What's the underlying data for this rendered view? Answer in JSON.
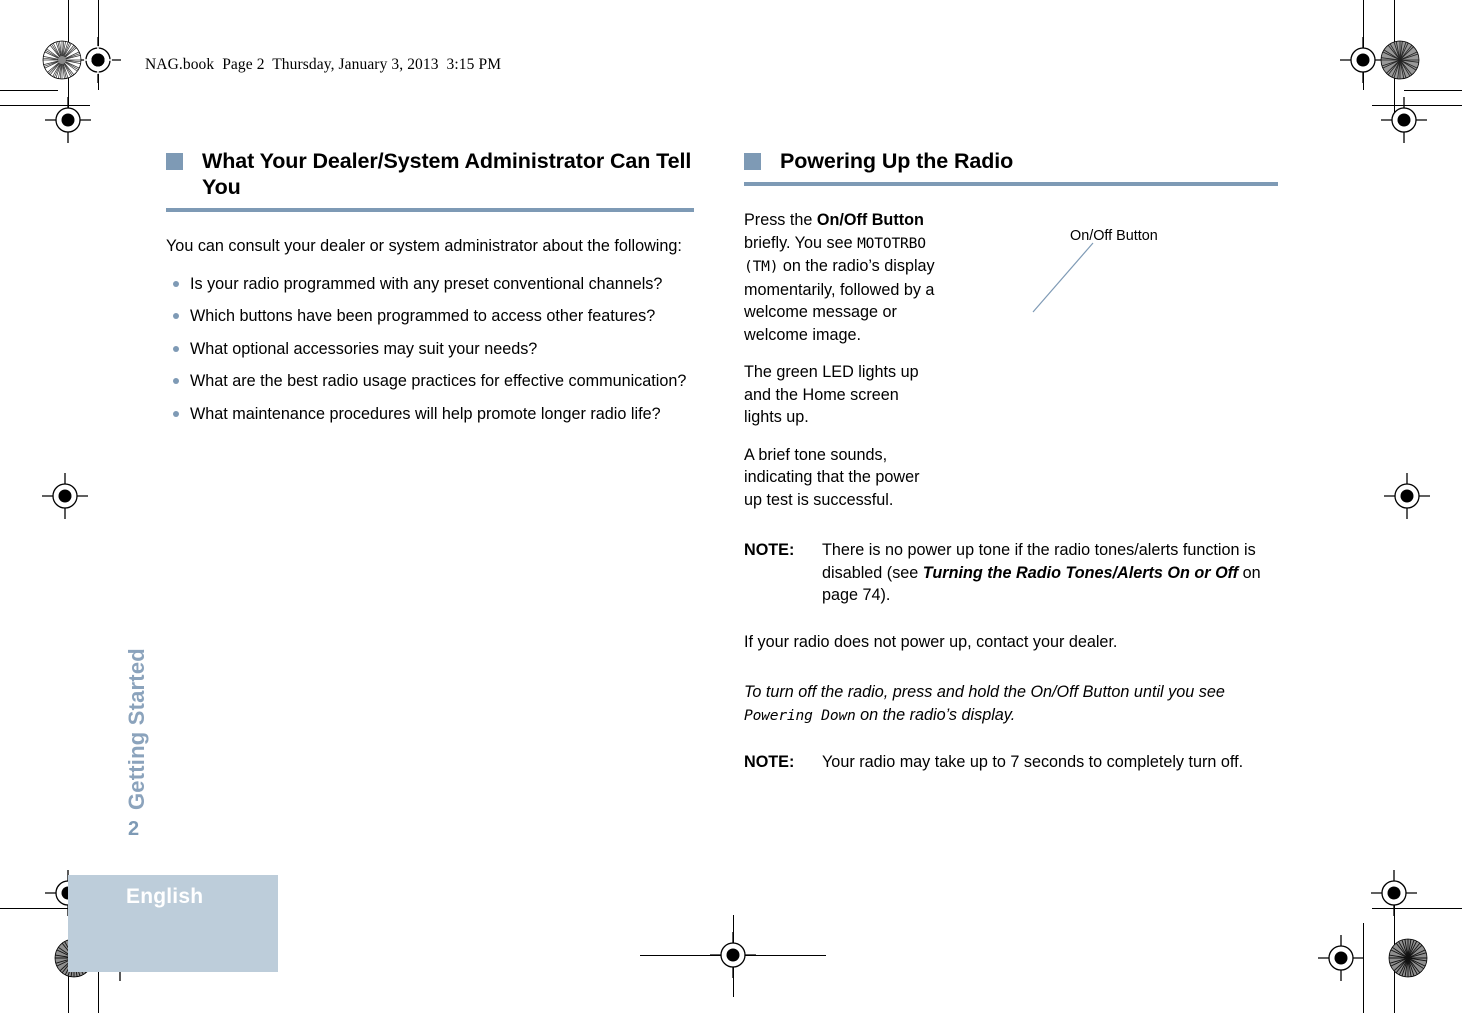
{
  "running_header": "NAG.book  Page 2  Thursday, January 3, 2013  3:15 PM",
  "colors": {
    "accent_rule": "#7e9ab5",
    "footer_band": "#bdcdda",
    "side_tab_text": "#8ba3bc",
    "callout_line": "#7e9ab5"
  },
  "left_column": {
    "heading": "What Your Dealer/System Administrator Can Tell You",
    "intro": "You can consult your dealer or system administrator about the following:",
    "bullets": [
      "Is your radio programmed with any preset conventional channels?",
      "Which buttons have been programmed to access other features?",
      "What optional accessories may suit your needs?",
      "What are the best radio usage practices for effective communication?",
      "What maintenance procedures will help promote longer radio life?"
    ]
  },
  "right_column": {
    "heading": "Powering Up the Radio",
    "para1": {
      "a": "Press the ",
      "bold1": "On/Off Button",
      "b": " briefly. You see ",
      "lcd": "MOTOTRBO (TM)",
      "c": " on the radio’s display momentarily, followed by a welcome message or welcome image."
    },
    "para2": "The green LED lights up and the Home screen lights up.",
    "para3": "A brief tone sounds, indicating that the power up test is successful.",
    "note1": {
      "label": "NOTE:",
      "a": "There is no power up tone if the radio tones/alerts function is disabled (see ",
      "xref": "Turning the Radio Tones/Alerts On or Off",
      "b": " on page 74)."
    },
    "para4": "If your radio does not power up, contact your dealer.",
    "para5": {
      "a": "To turn off the radio, press and hold the On/Off Button until you see ",
      "lcd": "Powering Down",
      "b": " on the radio’s display."
    },
    "note2": {
      "label": "NOTE:",
      "text": "Your radio may take up to 7 seconds to completely turn off."
    },
    "callout_label": "On/Off Button"
  },
  "side_tab": "Getting Started",
  "page_number": "2",
  "footer_language": "English"
}
